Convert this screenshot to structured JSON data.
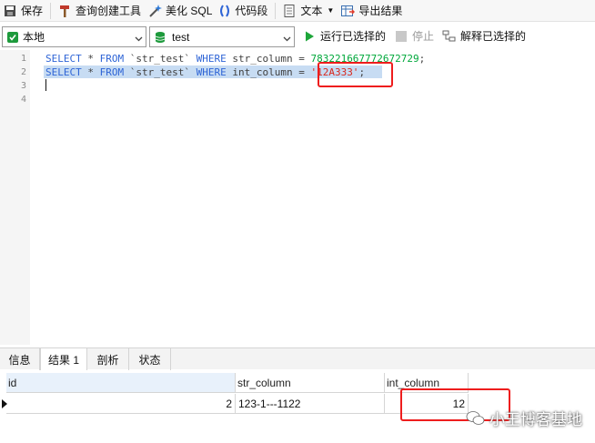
{
  "toolbar": {
    "save_label": "保存",
    "query_builder_label": "查询创建工具",
    "beautify_label": "美化 SQL",
    "snippet_label": "代码段",
    "text_label": "文本",
    "export_label": "导出结果"
  },
  "connection": {
    "local_value": "本地",
    "db_value": "test",
    "run_label": "运行已选择的",
    "stop_label": "停止",
    "explain_label": "解释已选择的"
  },
  "editor": {
    "line_numbers": [
      "1",
      "2",
      "3",
      "4"
    ],
    "lines": [
      {
        "kw1": "SELECT",
        "t1": " * ",
        "kw2": "FROM",
        "t2": " `str_test` ",
        "kw3": "WHERE",
        "t3": " str_column = ",
        "value": "783221667772672729",
        "end": ";"
      },
      {
        "kw1": "SELECT",
        "t1": " * ",
        "kw2": "FROM",
        "t2": " `str_test` ",
        "kw3": "WHERE",
        "t3": " int_column = ",
        "value": "'12A333'",
        "end": ";"
      }
    ]
  },
  "result_tabs": [
    "信息",
    "结果 1",
    "剖析",
    "状态"
  ],
  "grid": {
    "columns": [
      "id",
      "str_column",
      "int_column"
    ],
    "rows": [
      [
        "2",
        "123-1---1122",
        "12"
      ]
    ]
  },
  "watermark": "小王博客基地",
  "colors": {
    "keyword": "#2f65d6",
    "number": "#00a83b",
    "string": "#d9281d",
    "highlight": "#ee1d1d",
    "selection": "#c7dcf3"
  }
}
